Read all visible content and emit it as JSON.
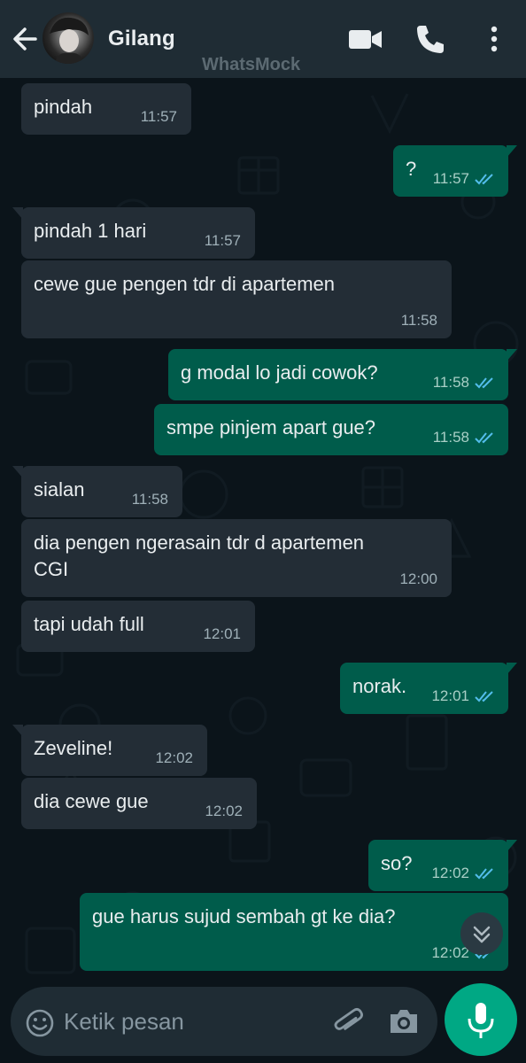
{
  "header": {
    "contact_name": "Gilang",
    "watermark": "WhatsMock",
    "icons": [
      "back-arrow-icon",
      "video-call-icon",
      "voice-call-icon",
      "more-options-icon"
    ]
  },
  "messages": [
    {
      "direction": "in",
      "text": "pindah",
      "time": "11:57"
    },
    {
      "direction": "out",
      "text": "?",
      "time": "11:57",
      "status": "read"
    },
    {
      "direction": "in",
      "text": "pindah 1 hari",
      "time": "11:57"
    },
    {
      "direction": "in",
      "text": "cewe gue pengen tdr di apartemen",
      "time": "11:58"
    },
    {
      "direction": "out",
      "text": "g modal lo jadi cowok?",
      "time": "11:58",
      "status": "read"
    },
    {
      "direction": "out",
      "text": "smpe pinjem apart gue?",
      "time": "11:58",
      "status": "read"
    },
    {
      "direction": "in",
      "text": "sialan",
      "time": "11:58"
    },
    {
      "direction": "in",
      "text_lines": [
        "dia pengen ngerasain tdr d apartemen",
        "CGI"
      ],
      "time": "12:00"
    },
    {
      "direction": "in",
      "text": "tapi udah full",
      "time": "12:01"
    },
    {
      "direction": "out",
      "text": "norak.",
      "time": "12:01",
      "status": "read"
    },
    {
      "direction": "in",
      "text": "Zeveline!",
      "time": "12:02"
    },
    {
      "direction": "in",
      "text": "dia cewe gue",
      "time": "12:02"
    },
    {
      "direction": "out",
      "text": "so?",
      "time": "12:02",
      "status": "read"
    },
    {
      "direction": "out",
      "text": "gue harus sujud sembah gt ke dia?",
      "time": "12:02",
      "status": "read"
    }
  ],
  "composer": {
    "placeholder": "Ketik pesan",
    "icons": [
      "emoji-icon",
      "attach-icon",
      "camera-icon",
      "mic-icon"
    ]
  },
  "colors": {
    "header_bg": "#1f2c34",
    "chat_bg": "#0b141a",
    "incoming_bubble": "#232d36",
    "outgoing_bubble": "#005c4b",
    "read_tick": "#53bdeb",
    "mic_button": "#00a884"
  }
}
